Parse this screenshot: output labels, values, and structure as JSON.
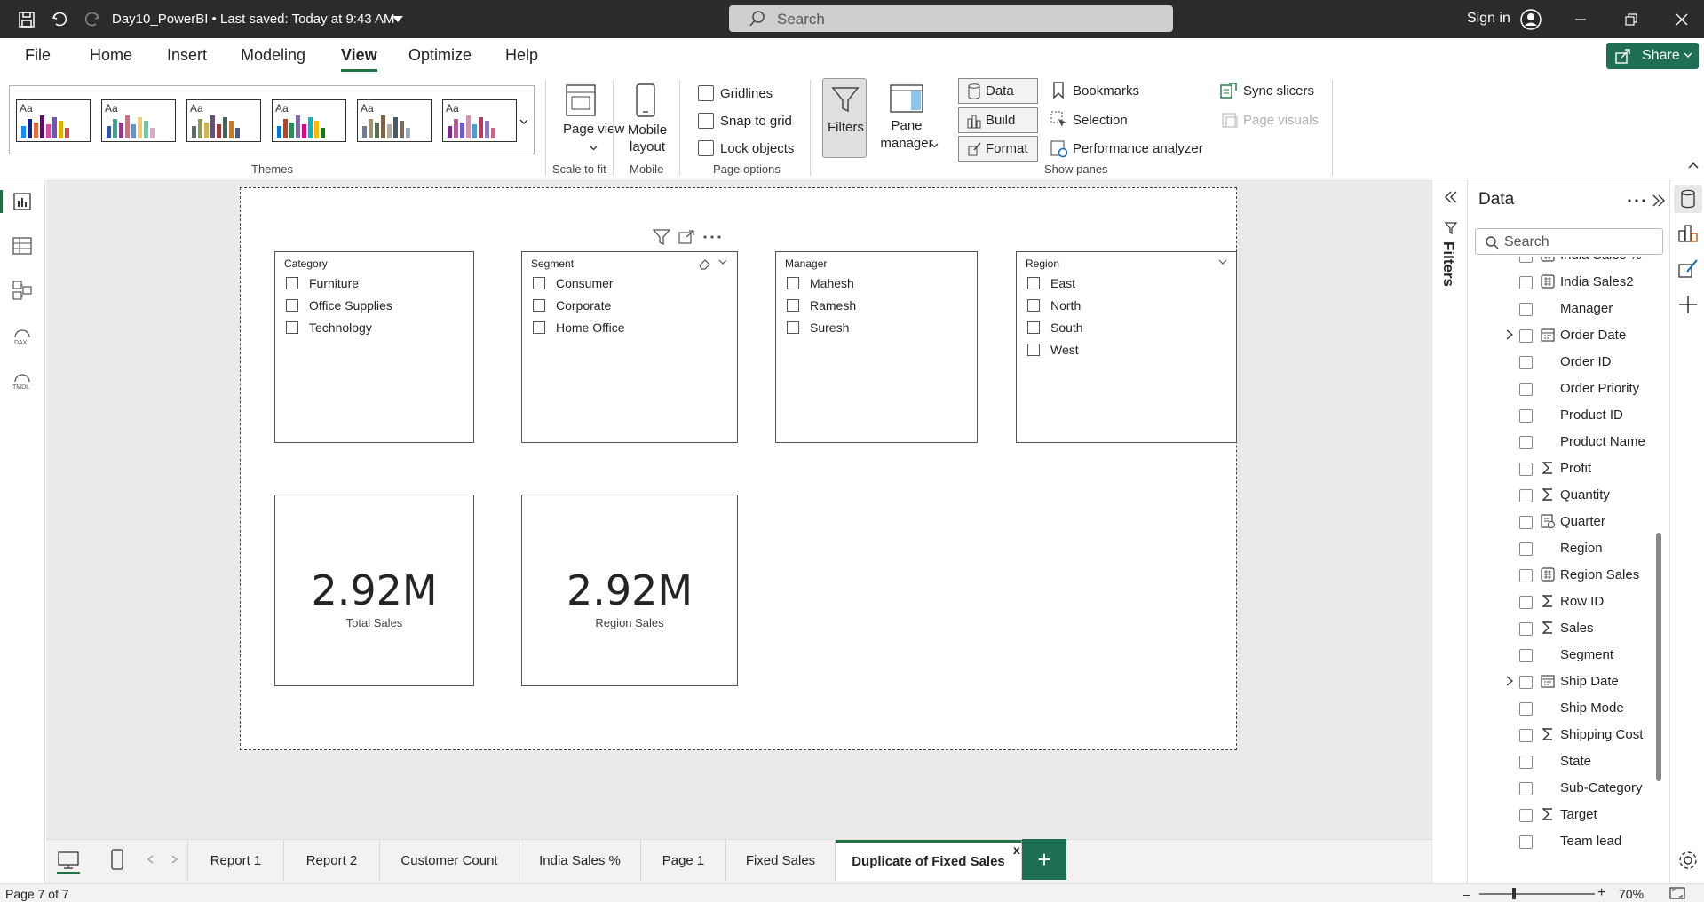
{
  "titlebar": {
    "doc_title": "Day10_PowerBI • Last saved: Today at 9:43 AM",
    "search_placeholder": "Search",
    "signin": "Sign in"
  },
  "ribbon_tabs": [
    "File",
    "Home",
    "Insert",
    "Modeling",
    "View",
    "Optimize",
    "Help"
  ],
  "share_label": "Share",
  "ribbon": {
    "themes_label": "Themes",
    "page_view": "Page view",
    "scale_to_fit": "Scale to fit",
    "mobile_layout": "Mobile layout",
    "mobile_label": "Mobile",
    "gridlines": "Gridlines",
    "snap_to_grid": "Snap to grid",
    "lock_objects": "Lock objects",
    "page_options": "Page options",
    "filters": "Filters",
    "pane_manager": "Pane manager",
    "data_btn": "Data",
    "build_btn": "Build",
    "format_btn": "Format",
    "bookmarks": "Bookmarks",
    "selection": "Selection",
    "performance_analyzer": "Performance analyzer",
    "sync_slicers": "Sync slicers",
    "page_visuals": "Page visuals",
    "show_panes": "Show panes",
    "theme_aa": "Aa"
  },
  "slicers": [
    {
      "title": "Category",
      "items": [
        "Furniture",
        "Office Supplies",
        "Technology"
      ]
    },
    {
      "title": "Segment",
      "items": [
        "Consumer",
        "Corporate",
        "Home Office"
      ]
    },
    {
      "title": "Manager",
      "items": [
        "Mahesh",
        "Ramesh",
        "Suresh"
      ]
    },
    {
      "title": "Region",
      "items": [
        "East",
        "North",
        "South",
        "West"
      ]
    }
  ],
  "cards": [
    {
      "value": "2.92M",
      "label": "Total Sales"
    },
    {
      "value": "2.92M",
      "label": "Region Sales"
    }
  ],
  "page_tabs": [
    "Report 1",
    "Report 2",
    "Customer Count",
    "India Sales %",
    "Page 1",
    "Fixed Sales",
    "Duplicate of Fixed Sales"
  ],
  "active_tab": "Duplicate of Fixed Sales",
  "add_page": "+",
  "close_tab": "x",
  "status": {
    "page": "Page 7 of 7",
    "zoom": "70%"
  },
  "filters_label": "Filters",
  "data_pane": {
    "title": "Data",
    "search_placeholder": "Search",
    "fields": [
      {
        "name": "India Sales %",
        "icon": "measure"
      },
      {
        "name": "India Sales2",
        "icon": "measure"
      },
      {
        "name": "Manager",
        "icon": "none"
      },
      {
        "name": "Order Date",
        "icon": "date",
        "expandable": true
      },
      {
        "name": "Order ID",
        "icon": "none"
      },
      {
        "name": "Order Priority",
        "icon": "none"
      },
      {
        "name": "Product ID",
        "icon": "none"
      },
      {
        "name": "Product Name",
        "icon": "none"
      },
      {
        "name": "Profit",
        "icon": "sigma"
      },
      {
        "name": "Quantity",
        "icon": "sigma"
      },
      {
        "name": "Quarter",
        "icon": "calc-column"
      },
      {
        "name": "Region",
        "icon": "none"
      },
      {
        "name": "Region Sales",
        "icon": "measure"
      },
      {
        "name": "Row ID",
        "icon": "sigma"
      },
      {
        "name": "Sales",
        "icon": "sigma"
      },
      {
        "name": "Segment",
        "icon": "none"
      },
      {
        "name": "Ship Date",
        "icon": "date",
        "expandable": true
      },
      {
        "name": "Ship Mode",
        "icon": "none"
      },
      {
        "name": "Shipping Cost",
        "icon": "sigma"
      },
      {
        "name": "State",
        "icon": "none"
      },
      {
        "name": "Sub-Category",
        "icon": "none"
      },
      {
        "name": "Target",
        "icon": "sigma"
      },
      {
        "name": "Team lead",
        "icon": "none"
      }
    ]
  }
}
